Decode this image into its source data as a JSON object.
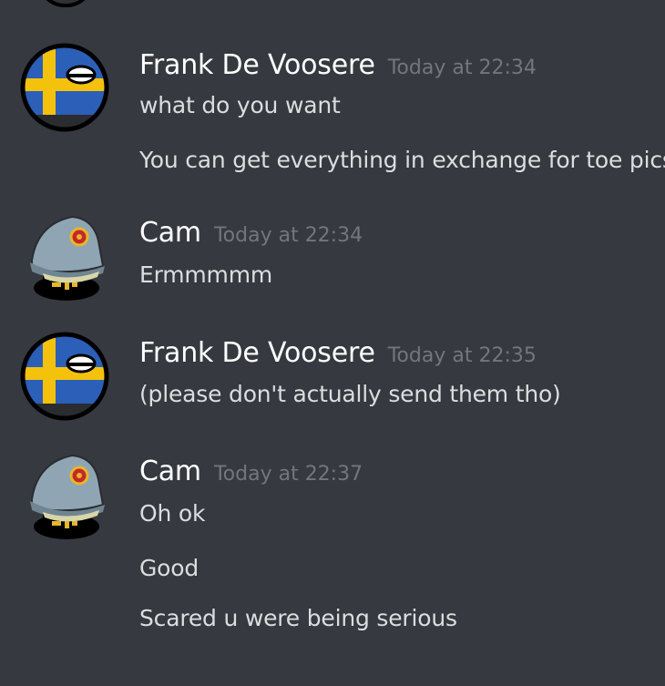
{
  "messages": [
    {
      "author": "Frank De Voosere",
      "avatar_icon": "sweden-countryball-icon",
      "timestamp": "Today at 22:34",
      "lines": [
        "what do you want",
        "You can get everything in exchange for toe pics"
      ]
    },
    {
      "author": "Cam",
      "avatar_icon": "officer-cap-countryball-icon",
      "timestamp": "Today at 22:34",
      "lines": [
        "Ermmmmm"
      ]
    },
    {
      "author": "Frank De Voosere",
      "avatar_icon": "sweden-countryball-icon",
      "timestamp": "Today at 22:35",
      "lines": [
        "(please don't actually send them tho)"
      ]
    },
    {
      "author": "Cam",
      "avatar_icon": "officer-cap-countryball-icon",
      "timestamp": "Today at 22:37",
      "lines": [
        "Oh ok",
        "Good",
        "Scared u were being serious"
      ]
    }
  ],
  "colors": {
    "background": "#36393f",
    "username": "#ffffff",
    "timestamp": "#72767d",
    "text": "#dcddde",
    "sweden_blue": "#2c5fb8",
    "sweden_yellow": "#f4c20d"
  }
}
